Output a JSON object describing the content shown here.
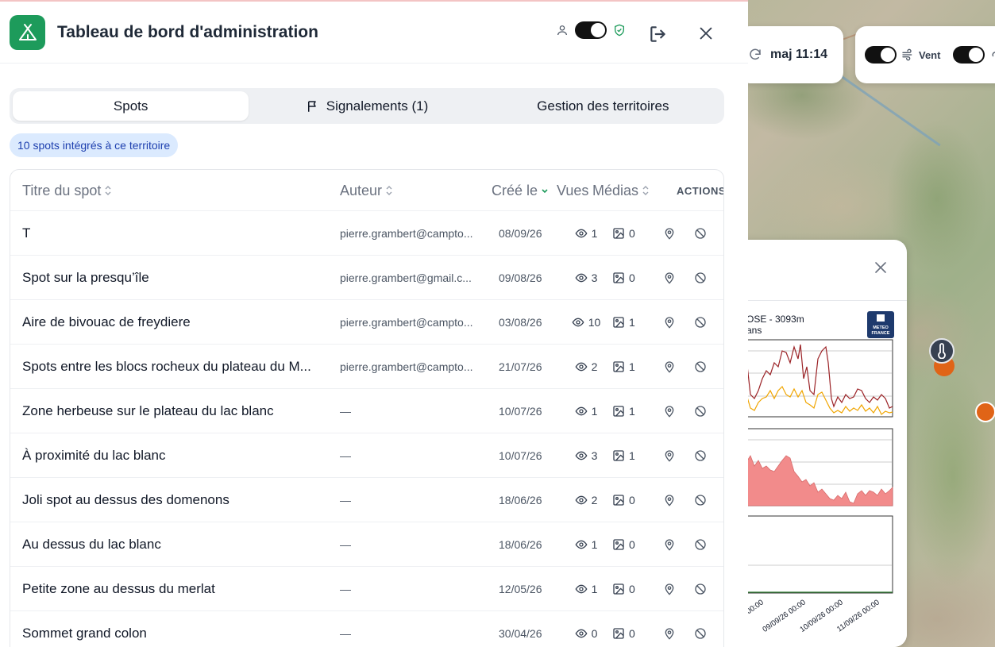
{
  "header": {
    "title": "Tableau de bord d'administration"
  },
  "tabs": [
    {
      "label": "Spots",
      "active": true
    },
    {
      "label": "Signalements (1)",
      "active": false,
      "icon": "flag-icon"
    },
    {
      "label": "Gestion des territoires",
      "active": false
    }
  ],
  "badge": "10 spots intégrés à ce territoire",
  "table": {
    "columns": {
      "title": "Titre du spot",
      "author": "Auteur",
      "created": "Créé le",
      "views": "Vues",
      "media": "Médias",
      "actions": "ACTIONS"
    },
    "rows": [
      {
        "title": "T",
        "author": "pierre.grambert@campto...",
        "date": "08/09/26",
        "views": "1",
        "media": "0"
      },
      {
        "title": "Spot sur la presqu’île",
        "author": "pierre.grambert@gmail.c...",
        "date": "09/08/26",
        "views": "3",
        "media": "0"
      },
      {
        "title": "Aire de bivouac de freydiere",
        "author": "pierre.grambert@campto...",
        "date": "03/08/26",
        "views": "10",
        "media": "1"
      },
      {
        "title": "Spots entre les blocs rocheux du plateau du M...",
        "author": "pierre.grambert@campto...",
        "date": "21/07/26",
        "views": "2",
        "media": "1"
      },
      {
        "title": "Zone herbeuse sur le plateau du lac blanc",
        "author": "—",
        "date": "10/07/26",
        "views": "1",
        "media": "1"
      },
      {
        "title": "À proximité du lac blanc",
        "author": "—",
        "date": "10/07/26",
        "views": "3",
        "media": "1"
      },
      {
        "title": "Joli spot au dessus des domenons",
        "author": "—",
        "date": "18/06/26",
        "views": "2",
        "media": "0"
      },
      {
        "title": "Au dessus du lac blanc",
        "author": "—",
        "date": "18/06/26",
        "views": "1",
        "media": "0"
      },
      {
        "title": "Petite zone au dessus du merlat",
        "author": "—",
        "date": "12/05/26",
        "views": "1",
        "media": "0"
      },
      {
        "title": "Sommet grand colon",
        "author": "—",
        "date": "30/04/26",
        "views": "0",
        "media": "0"
      }
    ]
  },
  "map": {
    "update_label": "maj 11:14",
    "wind_label": "Vent"
  },
  "weather": {
    "station_label": "OSE - 3093m",
    "station_sub": "ans",
    "provider_logo": "METEO FRANCE",
    "x_ticks": [
      "00:00",
      "09/09/26 00:00",
      "10/09/26 00:00",
      "11/09/26 00:00"
    ]
  },
  "colors": {
    "brand_green": "#1d9b5b",
    "line_dark_red": "#9b2226",
    "line_orange": "#f0a500",
    "area_red": "#f28b8b",
    "marker_orange": "#e06417"
  }
}
